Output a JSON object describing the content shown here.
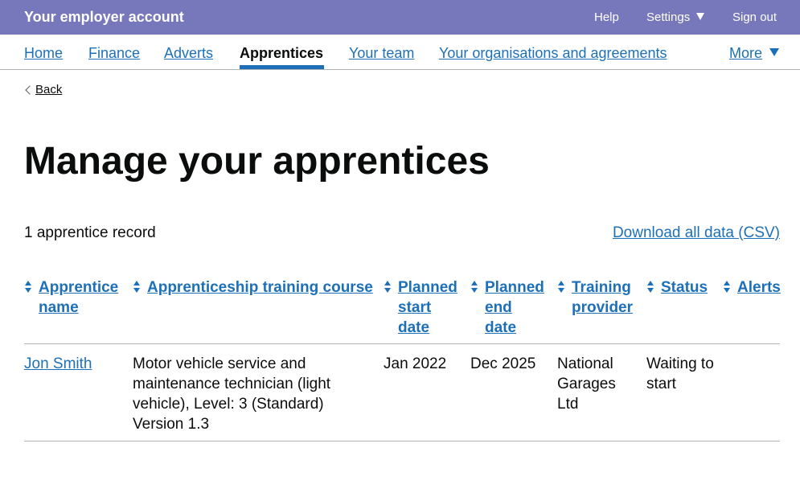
{
  "header": {
    "title": "Your employer account",
    "help": "Help",
    "settings": "Settings",
    "sign_out": "Sign out"
  },
  "nav": {
    "items": [
      {
        "label": "Home"
      },
      {
        "label": "Finance"
      },
      {
        "label": "Adverts"
      },
      {
        "label": "Apprentices",
        "active": true
      },
      {
        "label": "Your team"
      },
      {
        "label": "Your organisations and agreements"
      }
    ],
    "more": "More"
  },
  "back": "Back",
  "page_title": "Manage your apprentices",
  "record_count": "1 apprentice record",
  "download": "Download all data (CSV)",
  "table": {
    "columns": [
      "Apprentice name",
      "Apprenticeship training course",
      "Planned start date",
      "Planned end date",
      "Training provider",
      "Status",
      "Alerts"
    ],
    "rows": [
      {
        "name": "Jon Smith",
        "course": "Motor vehicle service and maintenance technician (light vehicle), Level: 3 (Standard) Version 1.3",
        "start": "Jan 2022",
        "end": "Dec 2025",
        "provider": "National Garages Ltd",
        "status": "Waiting to start",
        "alerts": ""
      }
    ]
  },
  "colors": {
    "header_bg": "#7777bb",
    "link": "#1d70b8",
    "text": "#0b0c0c",
    "border": "#b1b4b6"
  }
}
